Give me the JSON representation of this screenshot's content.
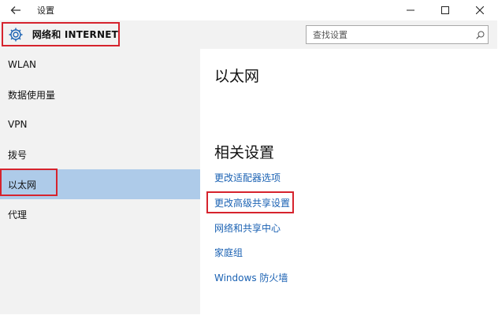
{
  "window": {
    "title": "设置",
    "controls": {
      "minimize": "—",
      "maximize": "☐",
      "close": "✕"
    }
  },
  "header": {
    "section_title": "网络和 INTERNET",
    "icon": "gear-icon"
  },
  "search": {
    "placeholder": "查找设置",
    "icon": "search-icon"
  },
  "sidebar": {
    "items": [
      {
        "label": "WLAN",
        "selected": false
      },
      {
        "label": "数据使用量",
        "selected": false
      },
      {
        "label": "VPN",
        "selected": false
      },
      {
        "label": "拨号",
        "selected": false
      },
      {
        "label": "以太网",
        "selected": true
      },
      {
        "label": "代理",
        "selected": false
      }
    ]
  },
  "main": {
    "page_title": "以太网",
    "related_title": "相关设置",
    "links": [
      {
        "label": "更改适配器选项"
      },
      {
        "label": "更改高级共享设置"
      },
      {
        "label": "网络和共享中心"
      },
      {
        "label": "家庭组"
      },
      {
        "label": "Windows 防火墙"
      }
    ]
  },
  "colors": {
    "accent_link": "#1b62b3",
    "selected_bg": "#aecbe9",
    "highlight_box": "#d6232d",
    "panel_bg": "#f2f2f2"
  }
}
